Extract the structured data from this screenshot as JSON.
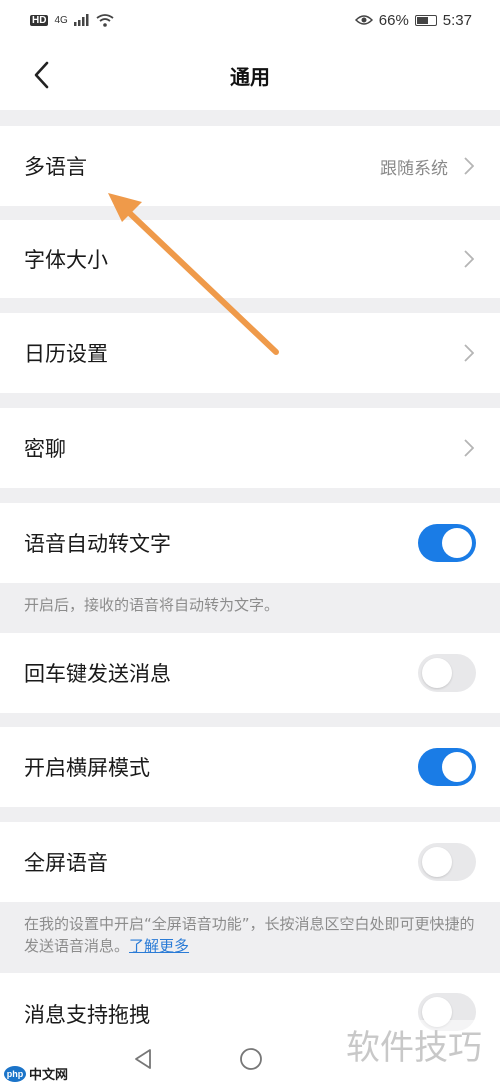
{
  "status_bar": {
    "network": "HD",
    "signal": "4G",
    "battery_percent": "66%",
    "battery_level": 0.66,
    "time": "5:37"
  },
  "header": {
    "title": "通用"
  },
  "settings": {
    "language": {
      "label": "多语言",
      "value": "跟随系统"
    },
    "font_size": {
      "label": "字体大小"
    },
    "calendar": {
      "label": "日历设置"
    },
    "private_chat": {
      "label": "密聊"
    },
    "voice_to_text": {
      "label": "语音自动转文字",
      "enabled": true,
      "description": "开启后，接收的语音将自动转为文字。"
    },
    "enter_send": {
      "label": "回车键发送消息",
      "enabled": false
    },
    "landscape": {
      "label": "开启横屏模式",
      "enabled": true
    },
    "fullscreen_voice": {
      "label": "全屏语音",
      "enabled": false,
      "description": "在我的设置中开启“全屏语音功能”，长按消息区空白处即可更快捷的发送语音消息。",
      "link": "了解更多"
    },
    "drag_support": {
      "label": "消息支持拖拽",
      "enabled": false
    }
  },
  "watermark": {
    "left_badge": "php",
    "left_text": "中文网",
    "right_text": "软件技巧"
  },
  "colors": {
    "accent": "#1a7ce6",
    "annotation_arrow": "#ef9a4a",
    "background": "#efeff1"
  }
}
